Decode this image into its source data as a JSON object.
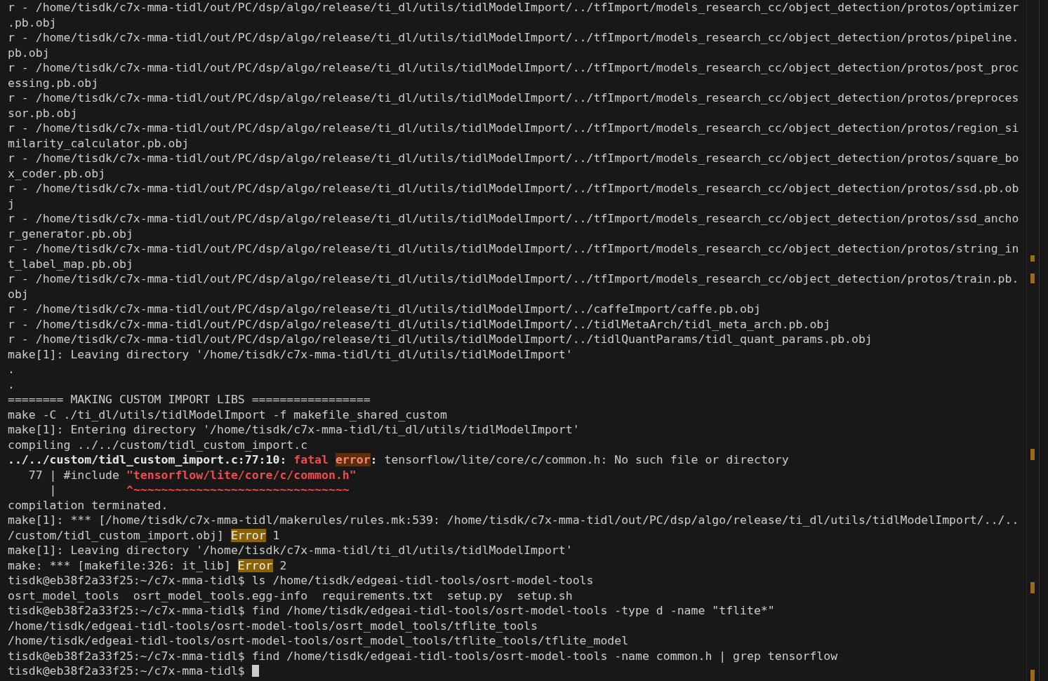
{
  "terminal": {
    "lines": [
      {
        "segments": [
          {
            "kind": "plain",
            "text": "r - /home/tisdk/c7x-mma-tidl/out/PC/dsp/algo/release/ti_dl/utils/tidlModelImport/../tfImport/models_research_cc/object_detection/protos/optimizer"
          }
        ]
      },
      {
        "segments": [
          {
            "kind": "plain",
            "text": ".pb.obj"
          }
        ]
      },
      {
        "segments": [
          {
            "kind": "plain",
            "text": "r - /home/tisdk/c7x-mma-tidl/out/PC/dsp/algo/release/ti_dl/utils/tidlModelImport/../tfImport/models_research_cc/object_detection/protos/pipeline."
          }
        ]
      },
      {
        "segments": [
          {
            "kind": "plain",
            "text": "pb.obj"
          }
        ]
      },
      {
        "segments": [
          {
            "kind": "plain",
            "text": "r - /home/tisdk/c7x-mma-tidl/out/PC/dsp/algo/release/ti_dl/utils/tidlModelImport/../tfImport/models_research_cc/object_detection/protos/post_proc"
          }
        ]
      },
      {
        "segments": [
          {
            "kind": "plain",
            "text": "essing.pb.obj"
          }
        ]
      },
      {
        "segments": [
          {
            "kind": "plain",
            "text": "r - /home/tisdk/c7x-mma-tidl/out/PC/dsp/algo/release/ti_dl/utils/tidlModelImport/../tfImport/models_research_cc/object_detection/protos/preproces"
          }
        ]
      },
      {
        "segments": [
          {
            "kind": "plain",
            "text": "sor.pb.obj"
          }
        ]
      },
      {
        "segments": [
          {
            "kind": "plain",
            "text": "r - /home/tisdk/c7x-mma-tidl/out/PC/dsp/algo/release/ti_dl/utils/tidlModelImport/../tfImport/models_research_cc/object_detection/protos/region_si"
          }
        ]
      },
      {
        "segments": [
          {
            "kind": "plain",
            "text": "milarity_calculator.pb.obj"
          }
        ]
      },
      {
        "segments": [
          {
            "kind": "plain",
            "text": "r - /home/tisdk/c7x-mma-tidl/out/PC/dsp/algo/release/ti_dl/utils/tidlModelImport/../tfImport/models_research_cc/object_detection/protos/square_bo"
          }
        ]
      },
      {
        "segments": [
          {
            "kind": "plain",
            "text": "x_coder.pb.obj"
          }
        ]
      },
      {
        "segments": [
          {
            "kind": "plain",
            "text": "r - /home/tisdk/c7x-mma-tidl/out/PC/dsp/algo/release/ti_dl/utils/tidlModelImport/../tfImport/models_research_cc/object_detection/protos/ssd.pb.ob"
          }
        ]
      },
      {
        "segments": [
          {
            "kind": "plain",
            "text": "j"
          }
        ]
      },
      {
        "segments": [
          {
            "kind": "plain",
            "text": "r - /home/tisdk/c7x-mma-tidl/out/PC/dsp/algo/release/ti_dl/utils/tidlModelImport/../tfImport/models_research_cc/object_detection/protos/ssd_ancho"
          }
        ]
      },
      {
        "segments": [
          {
            "kind": "plain",
            "text": "r_generator.pb.obj"
          }
        ]
      },
      {
        "segments": [
          {
            "kind": "plain",
            "text": "r - /home/tisdk/c7x-mma-tidl/out/PC/dsp/algo/release/ti_dl/utils/tidlModelImport/../tfImport/models_research_cc/object_detection/protos/string_in"
          }
        ]
      },
      {
        "segments": [
          {
            "kind": "plain",
            "text": "t_label_map.pb.obj"
          }
        ]
      },
      {
        "segments": [
          {
            "kind": "plain",
            "text": "r - /home/tisdk/c7x-mma-tidl/out/PC/dsp/algo/release/ti_dl/utils/tidlModelImport/../tfImport/models_research_cc/object_detection/protos/train.pb."
          }
        ]
      },
      {
        "segments": [
          {
            "kind": "plain",
            "text": "obj"
          }
        ]
      },
      {
        "segments": [
          {
            "kind": "plain",
            "text": "r - /home/tisdk/c7x-mma-tidl/out/PC/dsp/algo/release/ti_dl/utils/tidlModelImport/../caffeImport/caffe.pb.obj"
          }
        ]
      },
      {
        "segments": [
          {
            "kind": "plain",
            "text": "r - /home/tisdk/c7x-mma-tidl/out/PC/dsp/algo/release/ti_dl/utils/tidlModelImport/../tidlMetaArch/tidl_meta_arch.pb.obj"
          }
        ]
      },
      {
        "segments": [
          {
            "kind": "plain",
            "text": "r - /home/tisdk/c7x-mma-tidl/out/PC/dsp/algo/release/ti_dl/utils/tidlModelImport/../tidlQuantParams/tidl_quant_params.pb.obj"
          }
        ]
      },
      {
        "segments": [
          {
            "kind": "plain",
            "text": "make[1]: Leaving directory '/home/tisdk/c7x-mma-tidl/ti_dl/utils/tidlModelImport'"
          }
        ]
      },
      {
        "segments": [
          {
            "kind": "plain",
            "text": "."
          }
        ]
      },
      {
        "segments": [
          {
            "kind": "plain",
            "text": "."
          }
        ]
      },
      {
        "segments": [
          {
            "kind": "plain",
            "text": "======== MAKING CUSTOM IMPORT LIBS ================="
          }
        ]
      },
      {
        "segments": [
          {
            "kind": "plain",
            "text": "make -C ./ti_dl/utils/tidlModelImport -f makefile_shared_custom"
          }
        ]
      },
      {
        "segments": [
          {
            "kind": "plain",
            "text": "make[1]: Entering directory '/home/tisdk/c7x-mma-tidl/ti_dl/utils/tidlModelImport'"
          }
        ]
      },
      {
        "segments": [
          {
            "kind": "plain",
            "text": "compiling ../../custom/tidl_custom_import.c"
          }
        ]
      },
      {
        "segments": [
          {
            "kind": "bold",
            "text": "../../custom/tidl_custom_import.c:77:10: "
          },
          {
            "kind": "fatal",
            "text": "fatal "
          },
          {
            "kind": "error",
            "text": "error"
          },
          {
            "kind": "bold",
            "text": ":"
          },
          {
            "kind": "plain",
            "text": " tensorflow/lite/core/c/common.h: No such file or directory"
          }
        ]
      },
      {
        "segments": [
          {
            "kind": "plain",
            "text": "   77 | #include "
          },
          {
            "kind": "fatal",
            "text": "\"tensorflow/lite/core/c/common.h\""
          }
        ]
      },
      {
        "segments": [
          {
            "kind": "plain",
            "text": "      |          "
          },
          {
            "kind": "fatal",
            "text": "^~~~~~~~~~~~~~~~~~~~~~~~~~~~~~~~"
          }
        ]
      },
      {
        "segments": [
          {
            "kind": "plain",
            "text": "compilation terminated."
          }
        ]
      },
      {
        "segments": [
          {
            "kind": "plain",
            "text": "make[1]: *** [/home/tisdk/c7x-mma-tidl/makerules/rules.mk:539: /home/tisdk/c7x-mma-tidl/out/PC/dsp/algo/release/ti_dl/utils/tidlModelImport/../.."
          }
        ]
      },
      {
        "segments": [
          {
            "kind": "plain",
            "text": "/custom/tidl_custom_import.obj] "
          },
          {
            "kind": "warn",
            "text": "Error"
          },
          {
            "kind": "plain",
            "text": " 1"
          }
        ]
      },
      {
        "segments": [
          {
            "kind": "plain",
            "text": "make[1]: Leaving directory '/home/tisdk/c7x-mma-tidl/ti_dl/utils/tidlModelImport'"
          }
        ]
      },
      {
        "segments": [
          {
            "kind": "plain",
            "text": "make: *** [makefile:326: it_lib] "
          },
          {
            "kind": "warn",
            "text": "Error"
          },
          {
            "kind": "plain",
            "text": " 2"
          }
        ]
      },
      {
        "segments": [
          {
            "kind": "plain",
            "text": "tisdk@eb38f2a33f25:~/c7x-mma-tidl$ ls /home/tisdk/edgeai-tidl-tools/osrt-model-tools"
          }
        ]
      },
      {
        "segments": [
          {
            "kind": "plain",
            "text": "osrt_model_tools  osrt_model_tools.egg-info  requirements.txt  setup.py  setup.sh"
          }
        ]
      },
      {
        "segments": [
          {
            "kind": "plain",
            "text": "tisdk@eb38f2a33f25:~/c7x-mma-tidl$ find /home/tisdk/edgeai-tidl-tools/osrt-model-tools -type d -name \"tflite*\""
          }
        ]
      },
      {
        "segments": [
          {
            "kind": "plain",
            "text": "/home/tisdk/edgeai-tidl-tools/osrt-model-tools/osrt_model_tools/tflite_tools"
          }
        ]
      },
      {
        "segments": [
          {
            "kind": "plain",
            "text": "/home/tisdk/edgeai-tidl-tools/osrt-model-tools/osrt_model_tools/tflite_tools/tflite_model"
          }
        ]
      },
      {
        "segments": [
          {
            "kind": "plain",
            "text": "tisdk@eb38f2a33f25:~/c7x-mma-tidl$ find /home/tisdk/edgeai-tidl-tools/osrt-model-tools -name common.h | grep tensorflow"
          }
        ]
      },
      {
        "segments": [
          {
            "kind": "plain",
            "text": "tisdk@eb38f2a33f25:~/c7x-mma-tidl$ "
          }
        ],
        "cursor": true
      }
    ]
  }
}
